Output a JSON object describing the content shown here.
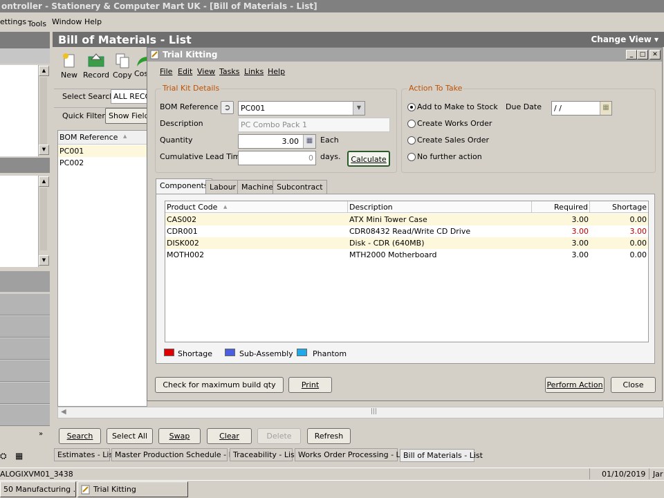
{
  "app_title": "ontroller - Stationery & Computer Mart UK - [Bill of Materials - List]",
  "menu": [
    "ettings",
    "Tools",
    "Window",
    "Help"
  ],
  "bom": {
    "title": "Bill of Materials - List",
    "change_view": "Change View",
    "toolbar": [
      "New",
      "Record",
      "Copy",
      "Cos"
    ],
    "select_search_label": "Select Search",
    "select_search_value": "ALL RECO",
    "quick_filter": "Quick Filter",
    "show_fields": "Show Fields",
    "list_header": "BOM Reference",
    "list_rows": [
      "PC001",
      "PC002"
    ],
    "bottom_buttons": {
      "search": "Search",
      "select_all": "Select All",
      "swap": "Swap",
      "clear": "Clear",
      "delete": "Delete",
      "refresh": "Refresh"
    }
  },
  "dialog": {
    "title": "Trial Kitting",
    "menu": [
      "File",
      "Edit",
      "View",
      "Tasks",
      "Links",
      "Help"
    ],
    "trial_kit": {
      "group_title": "Trial Kit Details",
      "bom_ref_label": "BOM Reference",
      "bom_ref_value": "PC001",
      "desc_label": "Description",
      "desc_value": "PC Combo Pack 1",
      "qty_label": "Quantity",
      "qty_value": "3.00",
      "qty_unit": "Each",
      "lead_label": "Cumulative Lead Time",
      "lead_value": "0",
      "lead_unit": "days.",
      "calculate": "Calculate"
    },
    "action": {
      "group_title": "Action To Take",
      "options": [
        "Add to Make to Stock",
        "Create Works Order",
        "Create Sales Order",
        "No further action"
      ],
      "selected": 0,
      "due_label": "Due Date",
      "due_value": "/ /"
    },
    "tabs": [
      "Components",
      "Labour",
      "Machine",
      "Subcontract"
    ],
    "grid": {
      "headers": [
        "Product Code",
        "Description",
        "Required",
        "Shortage"
      ],
      "rows": [
        {
          "code": "CAS002",
          "desc": "ATX Mini Tower Case",
          "req": "3.00",
          "short": "0.00",
          "red": false
        },
        {
          "code": "CDR001",
          "desc": "CDR08432 Read/Write CD Drive",
          "req": "3.00",
          "short": "3.00",
          "red": true
        },
        {
          "code": "DISK002",
          "desc": "Disk - CDR (640MB)",
          "req": "3.00",
          "short": "0.00",
          "red": false
        },
        {
          "code": "MOTH002",
          "desc": "MTH2000 Motherboard",
          "req": "3.00",
          "short": "0.00",
          "red": false
        }
      ]
    },
    "legend": [
      {
        "label": "Shortage",
        "color": "#e00000"
      },
      {
        "label": "Sub-Assembly",
        "color": "#4a5ee0"
      },
      {
        "label": "Phantom",
        "color": "#20a8e8"
      }
    ],
    "buttons": {
      "check": "Check for maximum build qty",
      "print": "Print",
      "perform": "Perform Action",
      "close": "Close"
    }
  },
  "task_tabs": [
    "Estimates - List",
    "Master Production Schedule - List",
    "Traceability - List",
    "Works Order Processing - List",
    "Bill of Materials - List"
  ],
  "status": {
    "left": "ALOGIXVM01_3438",
    "date": "01/10/2019",
    "right": "Jar"
  },
  "taskbar": [
    "50 Manufacturing ...",
    "Trial Kitting"
  ]
}
